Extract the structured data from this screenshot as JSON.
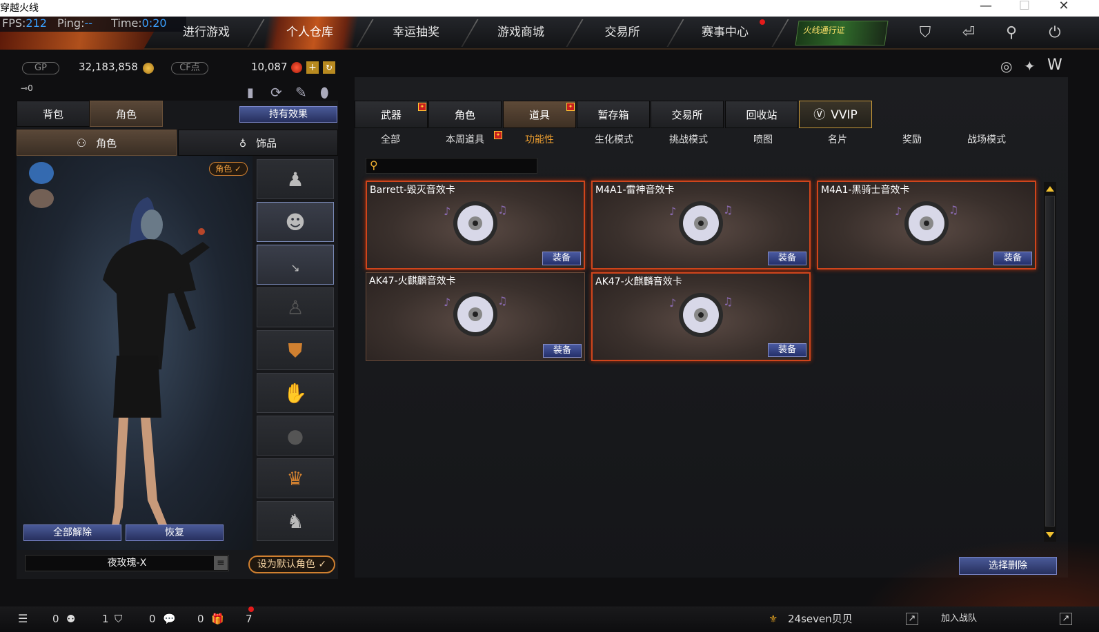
{
  "window": {
    "title": "穿越火线",
    "min": "—",
    "max": "☐",
    "close": "✕"
  },
  "stats": {
    "fps_label": "FPS:",
    "fps_value": "212",
    "ping_label": "Ping:",
    "ping_value": "--",
    "time_label": "Time:",
    "time_value": "0:20"
  },
  "nav": {
    "items": [
      {
        "label": "进行游戏"
      },
      {
        "label": "个人仓库",
        "active": true
      },
      {
        "label": "幸运抽奖"
      },
      {
        "label": "游戏商城"
      },
      {
        "label": "交易所"
      },
      {
        "label": "赛事中心"
      }
    ],
    "pass_label": "火线通行证"
  },
  "currency": {
    "gp_label": "GP",
    "gp_value": "32,183,858",
    "cf_label": "CF点",
    "cf_value": "10,087"
  },
  "left": {
    "key_count": "0",
    "tabs": [
      "背包",
      "角色"
    ],
    "effect_btn": "持有效果",
    "subtabs": [
      "角色",
      "饰品"
    ],
    "char_badge": "角色 ✓",
    "unequip_all": "全部解除",
    "restore": "恢复",
    "char_name": "夜玫瑰-X",
    "set_default": "设为默认角色 ✓"
  },
  "right": {
    "categories": [
      "武器",
      "角色",
      "道具",
      "暂存箱",
      "交易所",
      "回收站",
      "VVIP"
    ],
    "subcategories": [
      "全部",
      "本周道具",
      "功能性",
      "生化模式",
      "挑战模式",
      "喷图",
      "名片",
      "奖励",
      "战场模式"
    ],
    "selected_category": "道具",
    "selected_sub": "功能性",
    "search_placeholder": "",
    "equip_label": "装备",
    "select_delete": "选择删除",
    "items": [
      {
        "name": "Barrett-毁灭音效卡"
      },
      {
        "name": "M4A1-雷神音效卡"
      },
      {
        "name": "M4A1-黑骑士音效卡"
      },
      {
        "name": "AK47-火麒麟音效卡"
      },
      {
        "name": "AK47-火麒麟音效卡"
      }
    ]
  },
  "bottom": {
    "c1": "0",
    "c2": "1",
    "c3": "0",
    "c4": "0",
    "c5": "7",
    "user": "24seven贝贝",
    "join_clan": "加入战队"
  },
  "colors": {
    "accent": "#c2551c",
    "blue_button": "#3a4a88",
    "selected_sub": "#f0a030"
  }
}
